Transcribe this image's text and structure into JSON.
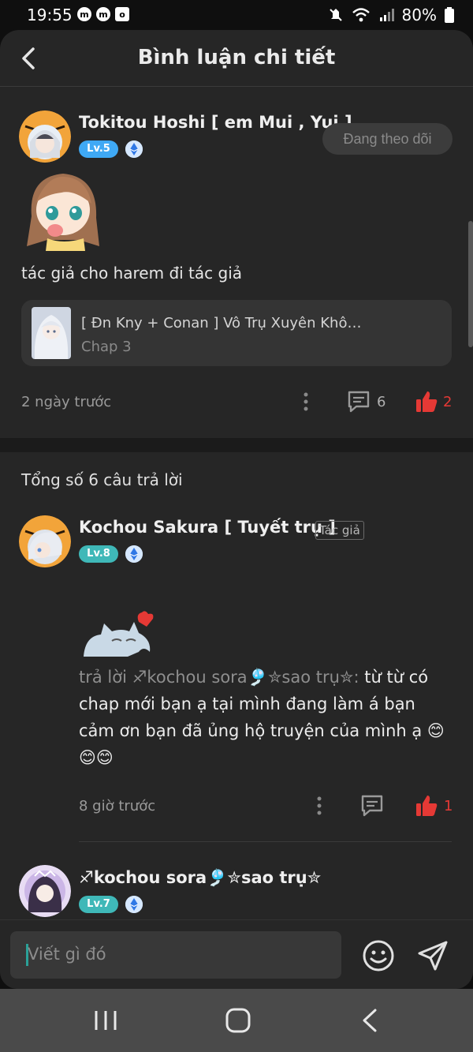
{
  "status_bar": {
    "time": "19:55",
    "battery": "80%",
    "notification_icons": [
      "m",
      "m",
      "o"
    ]
  },
  "header": {
    "title": "Bình luận chi tiết"
  },
  "comment": {
    "author": "Tokitou Hoshi [ em Mui , Yui ]",
    "level": "Lv.5",
    "follow_label": "Đang theo dõi",
    "text": "tác giả cho harem đi tác giả",
    "story": {
      "title": "[ Đn Kny + Conan ] Vô Trụ Xuyên Khô…",
      "chapter": "Chap 3"
    },
    "time": "2 ngày trước",
    "reply_count": "6",
    "like_count": "2"
  },
  "replies_section": {
    "title": "Tổng số 6 câu trả lời"
  },
  "replies": [
    {
      "author": "Kochou Sakura [ Tuyết trụ ]",
      "level": "Lv.8",
      "author_tag": "Tác giả",
      "reply_prefix": "trả lời ",
      "reply_to": "♐kochou sora🎐✮sao trụ✮: ",
      "text_line1": "từ từ có",
      "text_line2": "chap mới bạn ạ tại mình đang làm á bạn",
      "text_line3": "cảm ơn bạn đã ủng hộ truyện của mình ạ 😊",
      "text_line4": "😊😊",
      "time": "8 giờ trước",
      "like_count": "1"
    },
    {
      "author": "♐kochou sora🎐✮sao trụ✮",
      "level": "Lv.7"
    }
  ],
  "composer": {
    "placeholder": "Viết gì đó"
  },
  "colors": {
    "like_red": "#e53935",
    "level_blue": "#3fa9f5",
    "level_teal": "#3fb8b8",
    "background": "#262626"
  },
  "icons": [
    "back-arrow-icon",
    "diamond-icon",
    "more-vert-icon",
    "comment-icon",
    "thumbs-up-icon",
    "emoji-icon",
    "send-icon",
    "recents-icon",
    "home-icon",
    "nav-back-icon",
    "wifi-icon",
    "signal-icon",
    "mute-icon",
    "battery-icon"
  ]
}
